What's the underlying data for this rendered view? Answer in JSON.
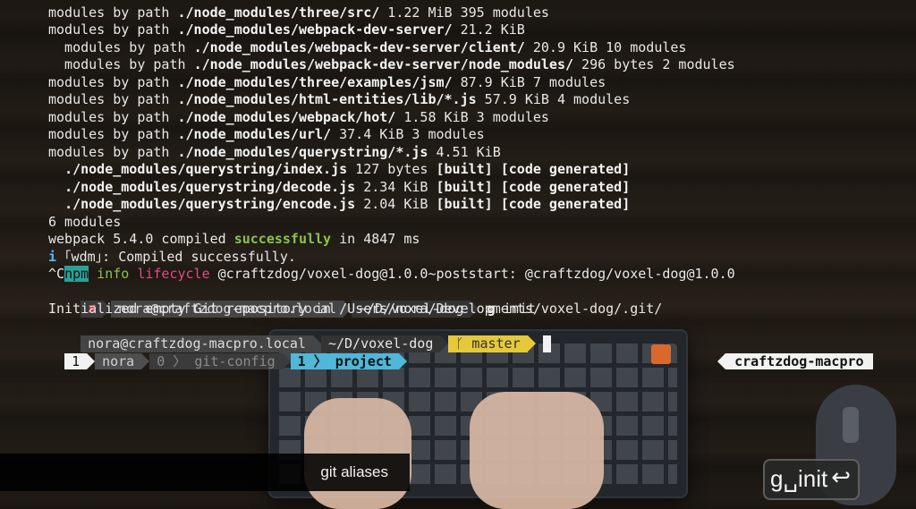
{
  "terminal": {
    "lines": [
      {
        "pre": "modules by path ",
        "bold": "./node_modules/three/src/",
        "post": " 1.22 MiB 395 modules"
      },
      {
        "pre": "modules by path ",
        "bold": "./node_modules/webpack-dev-server/",
        "post": " 21.2 KiB"
      },
      {
        "pre": "  modules by path ",
        "bold": "./node_modules/webpack-dev-server/client/",
        "post": " 20.9 KiB 10 modules"
      },
      {
        "pre": "  modules by path ",
        "bold": "./node_modules/webpack-dev-server/node_modules/",
        "post": " 296 bytes 2 modules"
      },
      {
        "pre": "modules by path ",
        "bold": "./node_modules/three/examples/jsm/",
        "post": " 87.9 KiB 7 modules"
      },
      {
        "pre": "modules by path ",
        "bold": "./node_modules/html-entities/lib/*.js",
        "post": " 57.9 KiB 4 modules"
      },
      {
        "pre": "modules by path ",
        "bold": "./node_modules/webpack/hot/",
        "post": " 1.58 KiB 3 modules"
      },
      {
        "pre": "modules by path ",
        "bold": "./node_modules/url/",
        "post": " 37.4 KiB 3 modules"
      },
      {
        "pre": "modules by path ",
        "bold": "./node_modules/querystring/*.js",
        "post": " 4.51 KiB"
      },
      {
        "pre": "  ",
        "bold": "./node_modules/querystring/index.js",
        "post": " 127 bytes ",
        "tag1": "[built]",
        "tag2": "[code generated]"
      },
      {
        "pre": "  ",
        "bold": "./node_modules/querystring/decode.js",
        "post": " 2.34 KiB ",
        "tag1": "[built]",
        "tag2": "[code generated]"
      },
      {
        "pre": "  ",
        "bold": "./node_modules/querystring/encode.js",
        "post": " 2.04 KiB ",
        "tag1": "[built]",
        "tag2": "[code generated]"
      }
    ],
    "modules_count": "6 modules",
    "compiled": {
      "pre": "webpack 5.4.0 compiled ",
      "bold": "successfully",
      "post": " in 4847 ms"
    },
    "wdm": {
      "icon": "i",
      "text": " ｢wdm｣: Compiled successfully."
    },
    "npm_line": {
      "ctrl": "^C",
      "npm": "npm",
      "info": " info ",
      "lifecycle": "lifecycle",
      "rest": " @craftzdog/voxel-dog@1.0.0~poststart: @craftzdog/voxel-dog@1.0.0"
    },
    "prompt1": {
      "x": "✘",
      "user": "nora@craftzdog-macpro.local",
      "path": "~/D/voxel-dog",
      "cmd_g": "g",
      "cmd_rest": " init"
    },
    "init_msg": "Initialized empty Git repository in /Users/nora/Developments/voxel-dog/.git/",
    "prompt2": {
      "user": "nora@craftzdog-macpro.local",
      "path": "~/D/voxel-dog",
      "branch_icon": "ᚴ",
      "branch": "master"
    }
  },
  "statusbar": {
    "session_num": "1",
    "session_name": "nora",
    "win0_num": "0",
    "win0_name": "git-config",
    "win1_num": "1",
    "win1_name": "project",
    "host": "craftzdog-macpro"
  },
  "caption": "git aliases",
  "keystroke": {
    "text": "g␣init",
    "return_icon": "↩"
  },
  "colors": {
    "accent_cyan": "#4fb7d8",
    "branch_yellow": "#e5c93b",
    "success_green": "#8bc34a",
    "lifecycle_pink": "#e14c8a"
  }
}
